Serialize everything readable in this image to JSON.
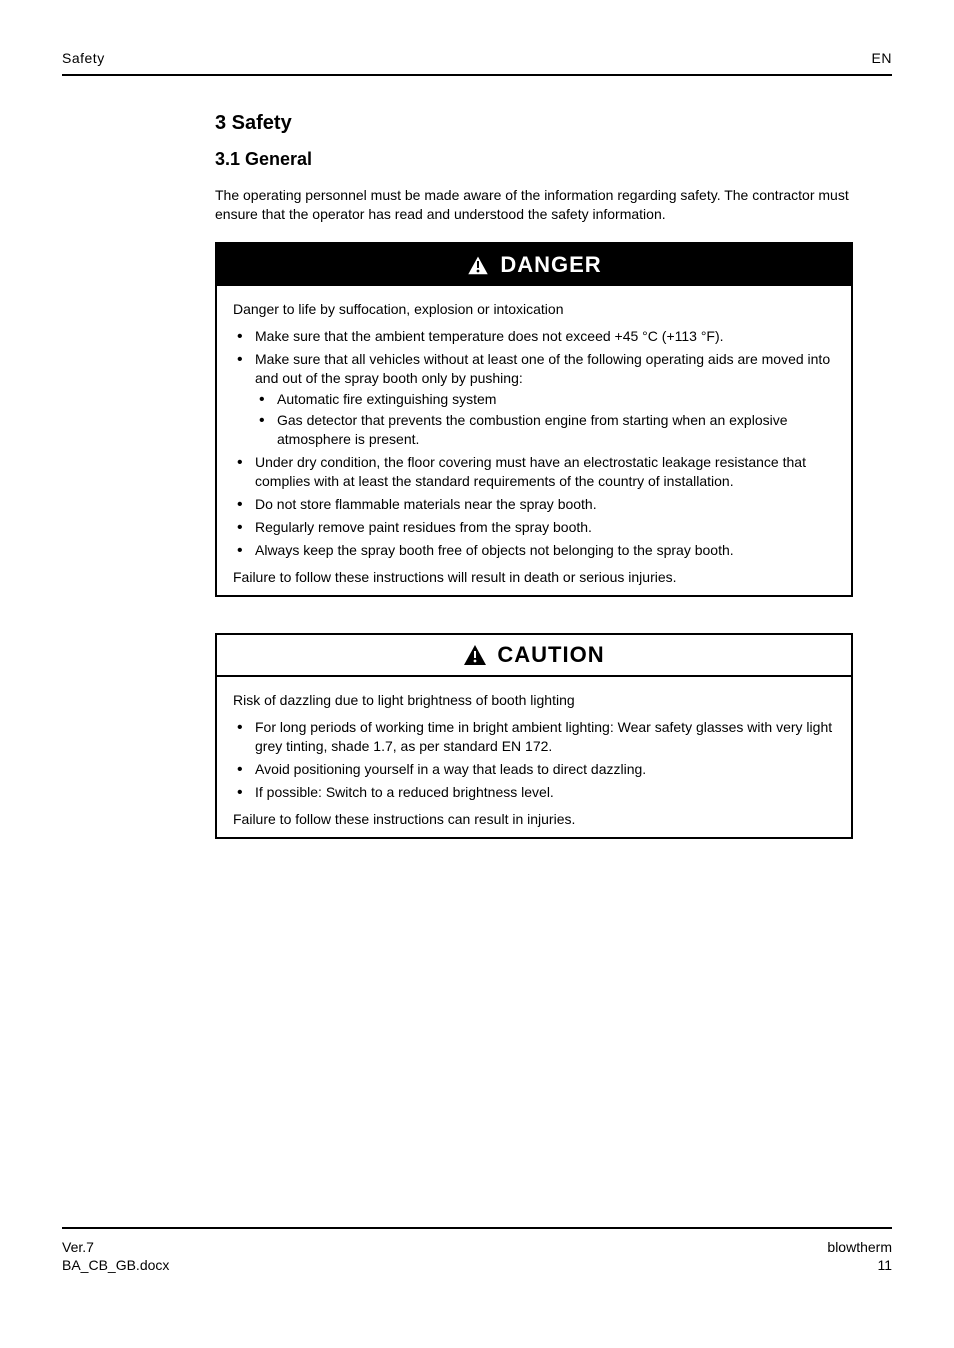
{
  "running_head": {
    "left": "Safety",
    "right": "EN"
  },
  "title": "3 Safety",
  "section_title": "3.1 General",
  "intro": "The operating personnel must be made aware of the information regarding safety. The contractor must ensure that the operator has read and understood the safety information.",
  "danger": {
    "label": "DANGER",
    "lead": "Danger to life by suffocation, explosion or intoxication",
    "items": [
      "Make sure that the ambient temperature does not exceed +45 °C (+113 °F).",
      "Make sure that all vehicles without at least one of the following operating aids are moved into and out of the spray booth only by pushing:",
      "",
      "Under dry condition, the floor covering must have an electrostatic leakage resistance that complies with at least the standard requirements of the country of installation.",
      "Do not store flammable materials near the spray booth.",
      "Regularly remove paint residues from the spray booth.",
      "Always keep the spray booth free of objects not belonging to the spray booth."
    ],
    "sub_items": [
      "Automatic fire extinguishing system",
      "Gas detector that prevents the combustion engine from starting when an explosive atmosphere is present."
    ],
    "failure": "Failure to follow these instructions will result in death or serious injuries."
  },
  "caution": {
    "label": "CAUTION",
    "lead": "Risk of dazzling due to light brightness of booth lighting",
    "items": [
      "For long periods of working time in bright ambient lighting: Wear safety glasses with very light grey tinting, shade 1.7, as per standard EN 172.",
      "Avoid positioning yourself in a way that leads to direct dazzling.",
      "If possible: Switch to a reduced brightness level."
    ],
    "failure": "Failure to follow these instructions can result in injuries."
  },
  "footer": {
    "left_line1": "Ver.7",
    "left_line2": "BA_CB_GB.docx",
    "right_line1": "blowtherm",
    "right_line2": "11"
  }
}
